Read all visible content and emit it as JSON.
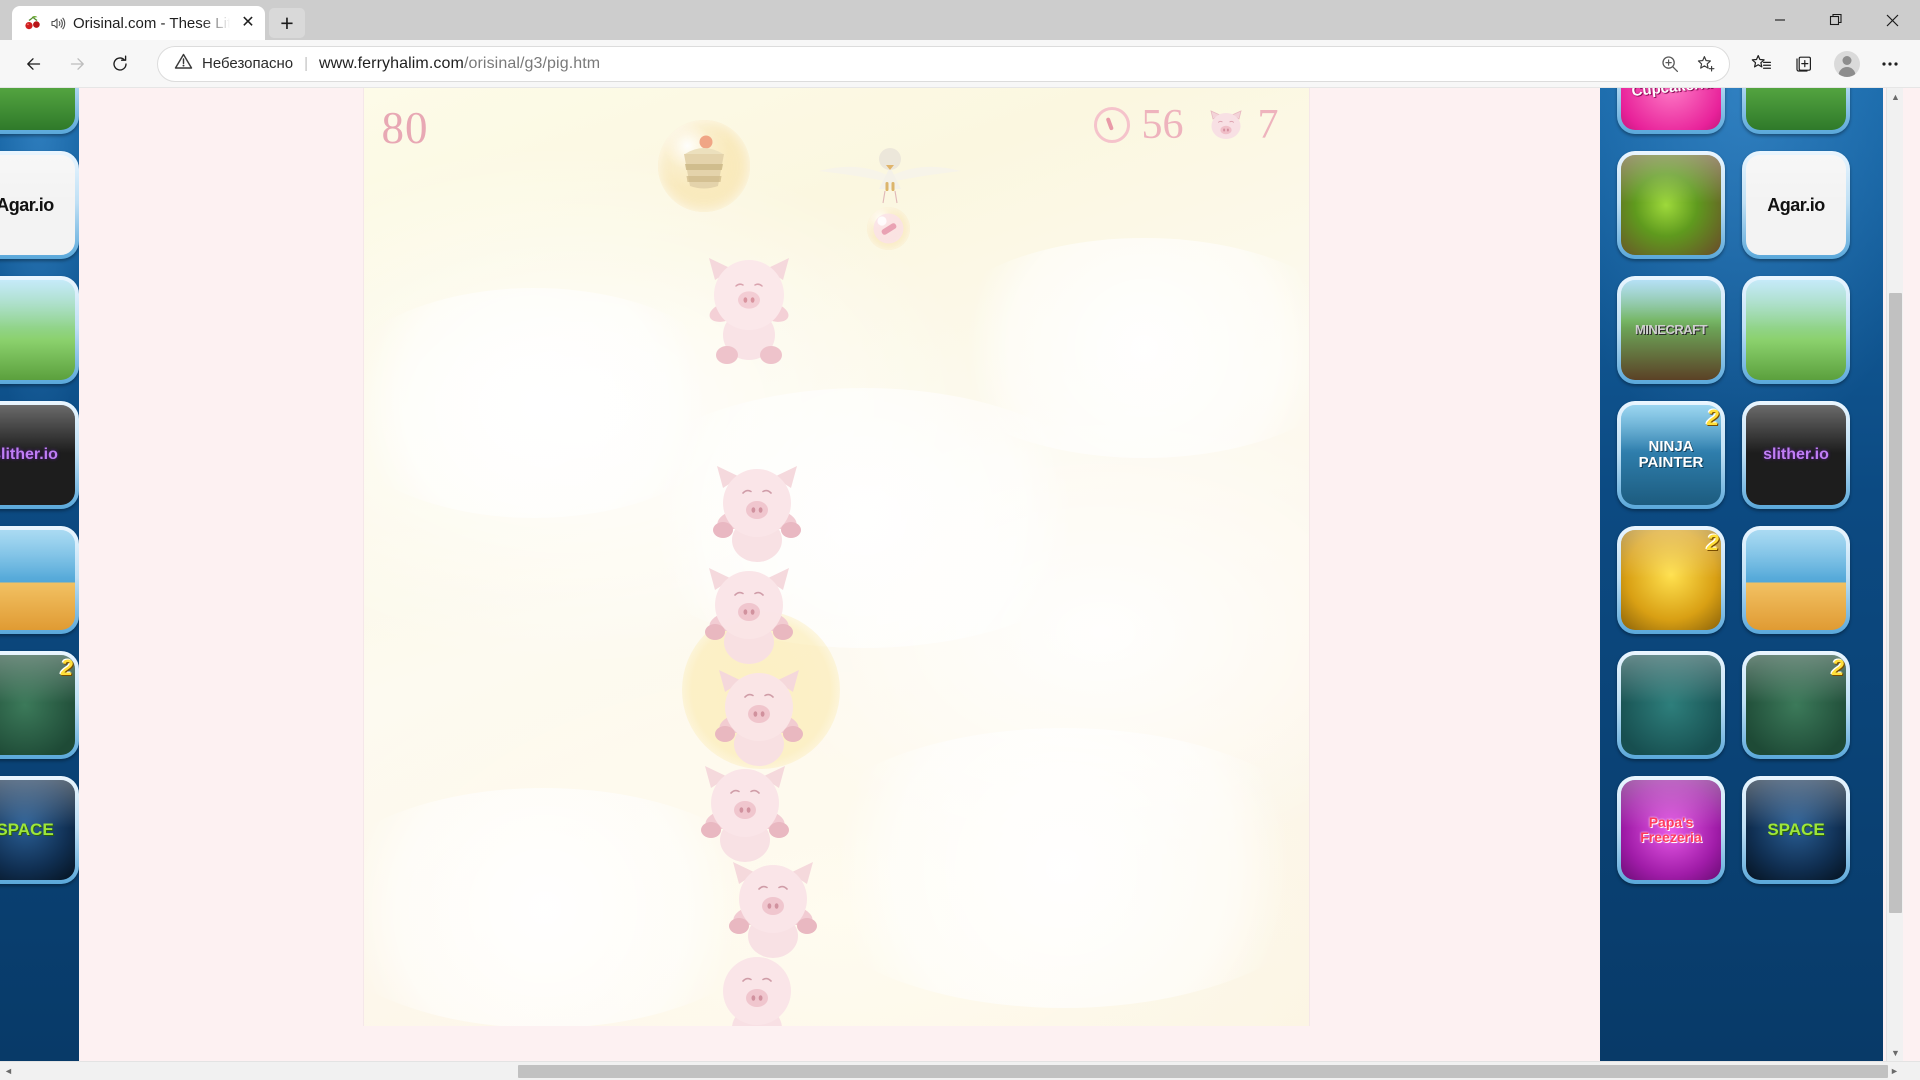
{
  "window": {
    "minimize_label": "Minimize",
    "maximize_label": "Restore",
    "close_label": "Close"
  },
  "tab": {
    "favicon": "cherry-icon",
    "audio_icon": "speaker-playing-icon",
    "title": "Orisinal.com - These Little Pigs",
    "close_label": "✕",
    "new_tab_label": "+"
  },
  "toolbar": {
    "back_label": "←",
    "forward_label": "→",
    "reload_label": "↻",
    "security_text": "Небезопасно",
    "separator": "|",
    "url_host": "www.ferryhalim.com",
    "url_path": "/orisinal/g3/pig.htm",
    "url_full": "www.ferryhalim.com/orisinal/g3/pig.htm",
    "zoom_icon": "zoom-in-icon",
    "favorite_icon": "add-favorite-star-icon",
    "favorites_icon": "favorites-list-icon",
    "collections_icon": "collections-icon",
    "profile_icon": "profile-avatar-icon",
    "settings_icon": "more-settings-icon"
  },
  "game": {
    "name": "These Little Pigs",
    "score": "80",
    "timer_value": "56",
    "timer_icon": "clock-icon",
    "lives_value": "7",
    "lives_icon": "pig-head-icon",
    "score_color": "#e8a8b4",
    "hud_color": "#eeb3bd",
    "background_color": "#fdfbe8",
    "pig_color": "#f7dadd",
    "items": [
      {
        "name": "cupcake-bubble",
        "label": "Cupcake in bubble"
      },
      {
        "name": "bird-carrier",
        "label": "White bird carrying bandage bubble"
      },
      {
        "name": "pig-falling",
        "label": "Falling pig"
      },
      {
        "name": "pig-stack",
        "label": "Stack of pigs"
      }
    ]
  },
  "ads": {
    "left_rail": [
      {
        "name": "golf",
        "label": "",
        "art": "art-golf",
        "badge": ""
      },
      {
        "name": "agar-io",
        "label": "Agar.io",
        "art": "art-agar",
        "badge": ""
      },
      {
        "name": "angry-birds",
        "label": "",
        "art": "art-angrybirds",
        "badge": ""
      },
      {
        "name": "slither-io",
        "label": "slither.io",
        "art": "art-slither",
        "badge": ""
      },
      {
        "name": "moto-x3m",
        "label": "",
        "art": "art-moto",
        "badge": ""
      },
      {
        "name": "rowdy-wrestling",
        "label": "",
        "art": "art-rowdy",
        "badge": "2"
      },
      {
        "name": "angry-birds-space",
        "label": "SPACE",
        "art": "art-space",
        "badge": ""
      }
    ],
    "right_rail": [
      {
        "name": "papas-cupcakeria",
        "label": "Papa's Cupcakeria",
        "art": "art-cupcakeria",
        "badge": ""
      },
      {
        "name": "golf",
        "label": "",
        "art": "art-golf",
        "badge": ""
      },
      {
        "name": "fruit-ninja",
        "label": "",
        "art": "art-fruit",
        "badge": ""
      },
      {
        "name": "agar-io",
        "label": "Agar.io",
        "art": "art-agar",
        "badge": ""
      },
      {
        "name": "minecraft",
        "label": "MINECRAFT",
        "art": "art-minecraft",
        "badge": ""
      },
      {
        "name": "angry-birds",
        "label": "",
        "art": "art-angrybirds",
        "badge": ""
      },
      {
        "name": "ninja-painter-2",
        "label": "NINJA PAINTER",
        "art": "art-ninja",
        "badge": "2"
      },
      {
        "name": "slither-io",
        "label": "slither.io",
        "art": "art-slither",
        "badge": ""
      },
      {
        "name": "temple-run-2",
        "label": "",
        "art": "art-temple",
        "badge": "2"
      },
      {
        "name": "moto-x3m",
        "label": "",
        "art": "art-moto",
        "badge": ""
      },
      {
        "name": "viking-donkey",
        "label": "",
        "art": "art-viking",
        "badge": ""
      },
      {
        "name": "rowdy-wrestling",
        "label": "",
        "art": "art-rowdy",
        "badge": "2"
      },
      {
        "name": "papas-freezeria",
        "label": "Papa's Freezeria",
        "art": "art-freezeria",
        "badge": ""
      },
      {
        "name": "angry-birds-space",
        "label": "SPACE",
        "art": "art-space",
        "badge": ""
      }
    ]
  },
  "scrollbars": {
    "vertical_up": "▲",
    "vertical_down": "▼",
    "horizontal_left": "◄",
    "horizontal_right": "►"
  }
}
